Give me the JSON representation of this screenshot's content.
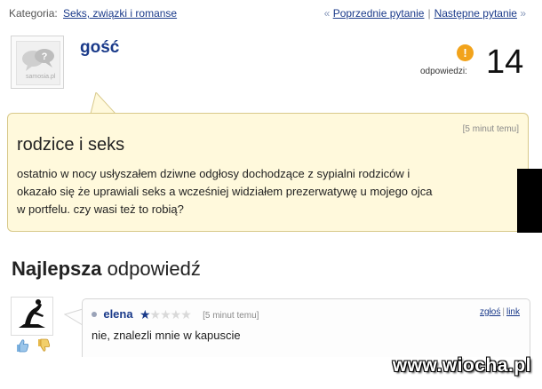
{
  "topbar": {
    "category_label": "Kategoria:",
    "category_link": "Seks, związki i romanse",
    "prev_arrow": "«",
    "prev_link": "Poprzednie pytanie",
    "separator": "|",
    "next_link": "Następne pytanie",
    "next_arrow": "»"
  },
  "asker": {
    "avatar_caption": "samosia.pl",
    "name": "gość",
    "answers_label": "odpowiedzi:",
    "answers_count": "14",
    "answers_icon_glyph": "!"
  },
  "question": {
    "time": "[5 minut temu]",
    "title": "rodzice i seks",
    "lines": [
      "ostatnio w nocy usłyszałem dziwne odgłosy dochodzące z sypialni rodziców i",
      "okazało się że uprawiali seks a wcześniej widziałem prezerwatywę u mojego ojca",
      "w portfelu. czy wasi też to robią?"
    ]
  },
  "best_answer": {
    "heading_bold": "Najlepsza",
    "heading_rest": "odpowiedź",
    "user": "elena",
    "rating": 1,
    "rating_max": 5,
    "time": "[5 minut temu]",
    "report_link": "zgłoś",
    "link_link": "link",
    "text": "nie, znalezli mnie w kapuscie"
  },
  "watermark": "www.wiocha.pl",
  "colors": {
    "link": "#1a3a8a",
    "bubble_bg": "#fff9dc",
    "bubble_border": "#d8c98a",
    "answers_icon": "#f2a31b"
  }
}
